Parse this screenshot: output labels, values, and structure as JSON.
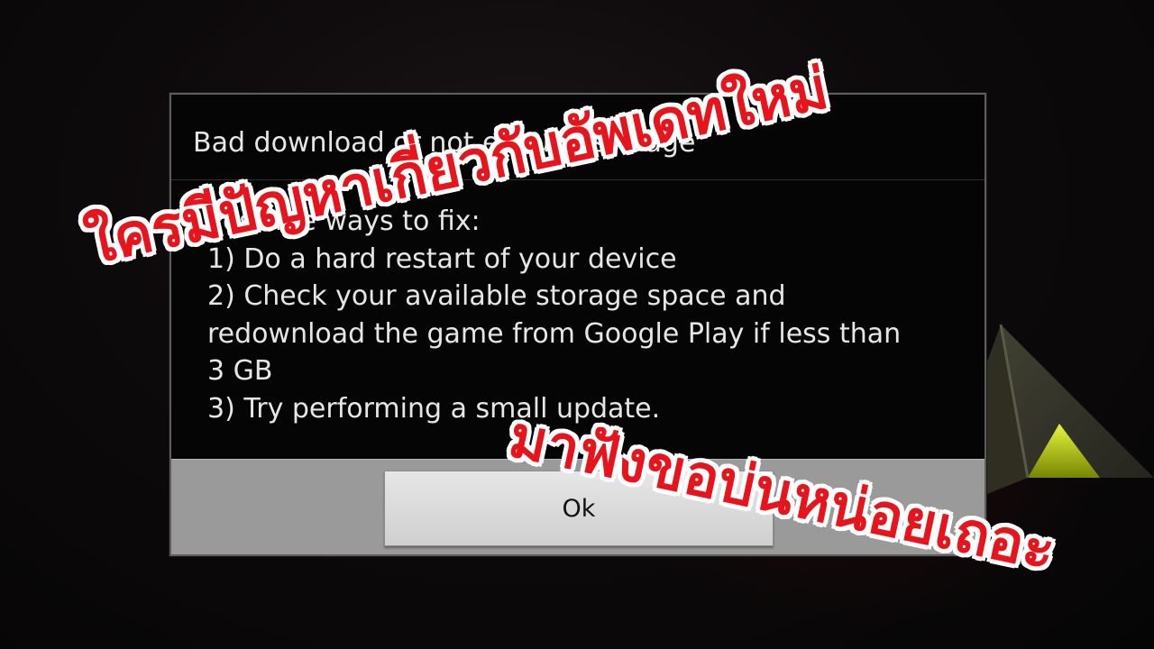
{
  "dialog": {
    "title": "Bad download or not enough storage",
    "message_lines": [
      "Possible ways to fix:",
      "1) Do a hard restart of your device",
      "2) Check your available storage space and",
      "redownload the game from Google Play if less than",
      "3 GB",
      "3) Try performing a small update."
    ],
    "ok_label": "Ok"
  },
  "overlay": {
    "line1": "ใครมีปัญหาเกี่ยวกับอัพเดทใหม่",
    "line2": "มาฟังขอบ่นหน่อยเถอะ",
    "text_color": "#e8141c",
    "outline_color": "#ffffff"
  },
  "background": {
    "logo_icon": "ark-logo-icon",
    "accent_color": "#c8d600"
  }
}
